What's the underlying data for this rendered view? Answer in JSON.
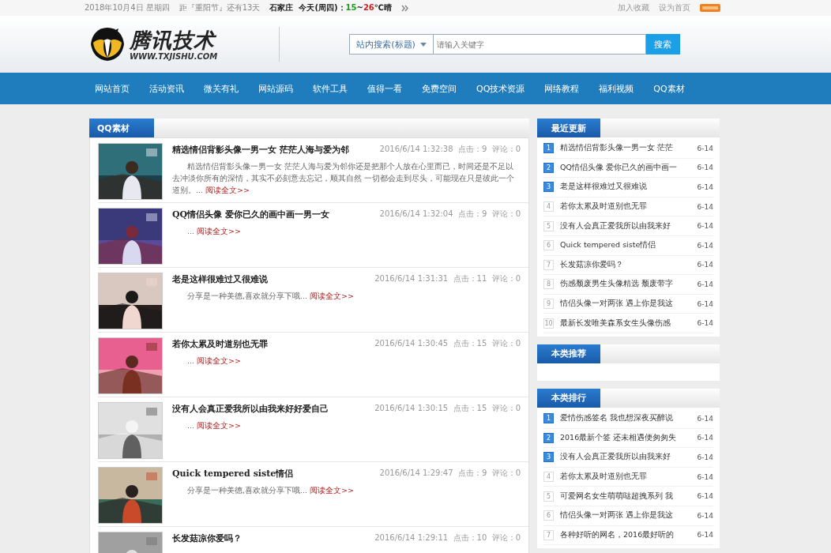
{
  "top_bar": {
    "date": "2018年10月4日 星期四",
    "festival": "距『重阳节』还有13天",
    "weather": {
      "city": "石家庄",
      "day": "今天(周四)：",
      "low": "15",
      "sep": "~",
      "high": "26",
      "suffix": "℃晴"
    },
    "links": [
      "加入收藏",
      "设为首页"
    ]
  },
  "header": {
    "logo_title": "腾讯技术",
    "logo_url": "WWW.TXJISHU.COM",
    "search": {
      "scope": "站内搜索(标题)",
      "placeholder": "请输入关键字",
      "button": "搜索"
    }
  },
  "nav": [
    "网站首页",
    "活动资讯",
    "微关有礼",
    "网站源码",
    "软件工具",
    "值得一看",
    "免费空间",
    "QQ技术资源",
    "网络教程",
    "福利视频",
    "QQ素材"
  ],
  "main": {
    "title": "QQ素材",
    "articles": [
      {
        "title": "精选情侣背影头像一男一女 茫茫人海与爱为邻",
        "time": "2016/6/14 1:32:38",
        "clicks": "点击：9",
        "comments": "评论：0",
        "summary": "精选情侣背影头像一男一女 茫茫人海与爱为邻你还是把那个人放在心里而已，时间还是不足以去冲淡你所有的深情，其实不必刻意去忘记，顺其自然 一切都会走到尽头，可能现在只是彼此一个道别。...",
        "link": "阅读全文>>"
      },
      {
        "title": "QQ情侣头像 爱你已久的画中画一男一女",
        "time": "2016/6/14 1:32:04",
        "clicks": "点击：9",
        "comments": "评论：0",
        "summary": "...",
        "link": "阅读全文>>"
      },
      {
        "title": "老是这样很难过又很难说",
        "time": "2016/6/14 1:31:31",
        "clicks": "点击：11",
        "comments": "评论：0",
        "summary": "分享是一种美德,喜欢就分享下哦...",
        "link": "阅读全文>>"
      },
      {
        "title": "若你太累及时道别也无罪",
        "time": "2016/6/14 1:30:45",
        "clicks": "点击：15",
        "comments": "评论：0",
        "summary": "...",
        "link": "阅读全文>>"
      },
      {
        "title": "没有人会真正爱我所以由我来好好爱自己",
        "time": "2016/6/14 1:30:15",
        "clicks": "点击：15",
        "comments": "评论：0",
        "summary": "...",
        "link": "阅读全文>>"
      },
      {
        "title": "Quick tempered siste情侣",
        "time": "2016/6/14 1:29:47",
        "clicks": "点击：9",
        "comments": "评论：0",
        "summary": "分享是一种美德,喜欢就分享下哦...",
        "link": "阅读全文>>"
      },
      {
        "title": "长发菇凉你爱吗？",
        "time": "2016/6/14 1:29:11",
        "clicks": "点击：10",
        "comments": "评论：0"
      }
    ]
  },
  "recent": {
    "title": "最近更新",
    "items": [
      {
        "num": "1",
        "top": true,
        "title": "精选情侣背影头像一男一女 茫茫",
        "date": "6-14"
      },
      {
        "num": "2",
        "top": true,
        "title": "QQ情侣头像 爱你已久的画中画一",
        "date": "6-14"
      },
      {
        "num": "3",
        "top": true,
        "title": "老是这样很难过又很难说",
        "date": "6-14"
      },
      {
        "num": "4",
        "top": false,
        "title": "若你太累及时道别也无罪",
        "date": "6-14"
      },
      {
        "num": "5",
        "top": false,
        "title": "没有人会真正爱我所以由我来好",
        "date": "6-14"
      },
      {
        "num": "6",
        "top": false,
        "title": "Quick tempered siste情侣",
        "date": "6-14"
      },
      {
        "num": "7",
        "top": false,
        "title": "长发菇凉你爱吗？",
        "date": "6-14"
      },
      {
        "num": "8",
        "top": false,
        "title": "伤感颓废男生头像精选 颓废带字",
        "date": "6-14"
      },
      {
        "num": "9",
        "top": false,
        "title": "情侣头像一对两张 遇上你是我这",
        "date": "6-14"
      },
      {
        "num": "10",
        "top": false,
        "title": "最新长发唯美森系女生头像伤感",
        "date": "6-14"
      }
    ]
  },
  "recommend": {
    "title": "本类推荐"
  },
  "ranking": {
    "title": "本类排行",
    "items": [
      {
        "num": "1",
        "top": true,
        "title": "爱情伤感签名 我也想深夜买醉说",
        "date": "6-14"
      },
      {
        "num": "2",
        "top": true,
        "title": "2016最新个签 还未相遇便匆匆失",
        "date": "6-14"
      },
      {
        "num": "3",
        "top": true,
        "title": "没有人会真正爱我所以由我来好",
        "date": "6-14"
      },
      {
        "num": "4",
        "top": false,
        "title": "若你太累及时道别也无罪",
        "date": "6-14"
      },
      {
        "num": "5",
        "top": false,
        "title": "可爱网名女生萌萌哒超拽系列 我",
        "date": "6-14"
      },
      {
        "num": "6",
        "top": false,
        "title": "情侣头像一对两张 遇上你是我这",
        "date": "6-14"
      },
      {
        "num": "7",
        "top": false,
        "title": "各种好听的网名，2016最好听的",
        "date": "6-14"
      }
    ]
  }
}
